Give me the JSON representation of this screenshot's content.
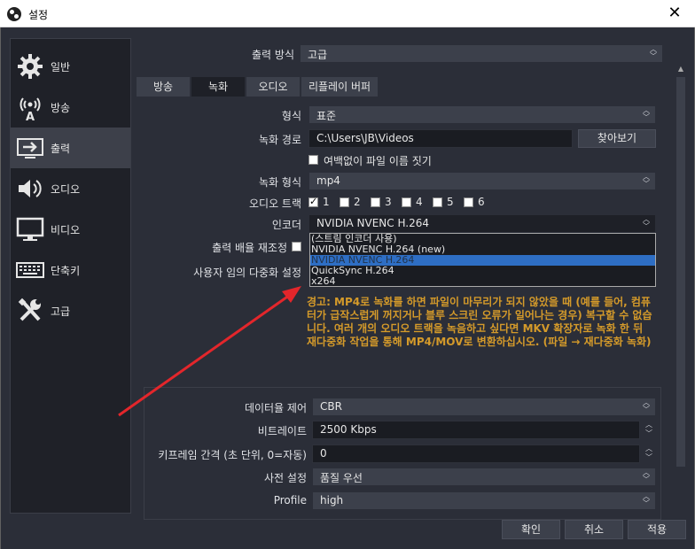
{
  "window": {
    "title": "설정"
  },
  "sidebar": {
    "items": [
      {
        "label": "일반",
        "icon": "gear-icon"
      },
      {
        "label": "방송",
        "icon": "broadcast-icon"
      },
      {
        "label": "출력",
        "icon": "output-icon",
        "active": true
      },
      {
        "label": "오디오",
        "icon": "speaker-icon"
      },
      {
        "label": "비디오",
        "icon": "monitor-icon"
      },
      {
        "label": "단축키",
        "icon": "keyboard-icon"
      },
      {
        "label": "고급",
        "icon": "tools-icon"
      }
    ]
  },
  "output_mode": {
    "label": "출력 방식",
    "value": "고급"
  },
  "tabs": [
    "방송",
    "녹화",
    "오디오",
    "리플레이 버퍼"
  ],
  "active_tab": "녹화",
  "recording": {
    "type_label": "형식",
    "type_value": "표준",
    "path_label": "녹화 경로",
    "path_value": "C:\\Users\\JB\\Videos",
    "browse_label": "찾아보기",
    "no_space_label": "여백없이 파일 이름 짓기",
    "format_label": "녹화 형식",
    "format_value": "mp4",
    "audio_track_label": "오디오 트랙",
    "tracks": [
      "1",
      "2",
      "3",
      "4",
      "5",
      "6"
    ],
    "encoder_label": "인코더",
    "encoder_value": "NVIDIA NVENC H.264",
    "rescale_label": "출력 배율 재조정",
    "custom_muxer_label": "사용자 임의 다중화 설정"
  },
  "encoder_options": [
    "(스트림 인코더 사용)",
    "NVIDIA NVENC H.264 (new)",
    "NVIDIA NVENC H.264",
    "QuickSync H.264",
    "x264"
  ],
  "warning": "경고: MP4로 녹화를 하면 파일이 마무리가 되지 않았을 때 (예를 들어, 컴퓨터가 급작스럽게 꺼지거나 블루 스크린 오류가 일어나는 경우) 복구할 수 없습니다. 여러 개의 오디오 트랙을 녹음하고 싶다면 MKV 확장자로 녹화 한 뒤 재다중화 작업을 통해 MP4/MOV로 변환하십시오. (파일 → 재다중화 녹화)",
  "encoder_settings": {
    "rate_control_label": "데이터율 제어",
    "rate_control_value": "CBR",
    "bitrate_label": "비트레이트",
    "bitrate_value": "2500 Kbps",
    "keyframe_label": "키프레임 간격 (초 단위, 0=자동)",
    "keyframe_value": "0",
    "preset_label": "사전 설정",
    "preset_value": "품질 우선",
    "profile_label": "Profile",
    "profile_value": "high"
  },
  "buttons": {
    "ok": "확인",
    "cancel": "취소",
    "apply": "적용"
  },
  "colors": {
    "accent": "#2e6ec4",
    "warning": "#d49a2a",
    "arrow": "#e3262b"
  }
}
